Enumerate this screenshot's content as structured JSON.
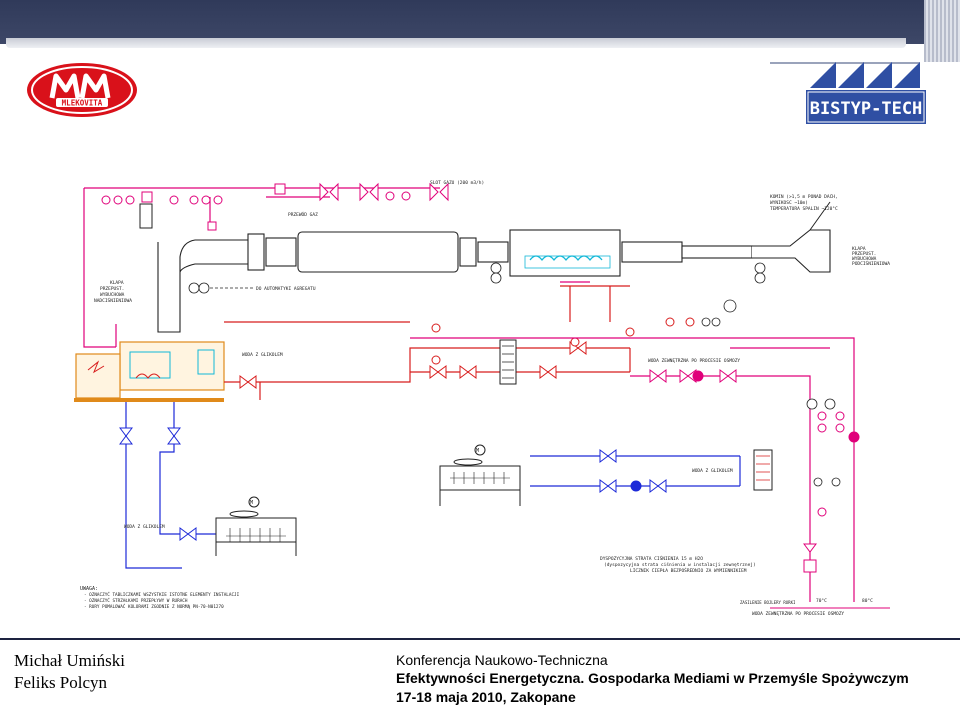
{
  "logos": {
    "left_text": "MLEKOVITA",
    "right_text": "BISTYP-TECH"
  },
  "diagram": {
    "labels": {
      "exhaust_top": "SLOT GAZU (200 m3/h)",
      "chimney_1": "KOMIN (>1,5 m PONAD DACH,",
      "chimney_2": "WYNIKOSC ~10m)",
      "chimney_3": "TEMPERATURA SPALIN ~120°C",
      "flap_right_1": "KLAPA",
      "flap_right_2": "PRZEPUST.",
      "flap_right_3": "WYBUCHOWA",
      "flap_right_4": "PODCIŚNIENIOWA",
      "flap_left_1": "KLAPA",
      "flap_left_2": "PRZEPUST.",
      "flap_left_3": "WYBUCHOWA",
      "flap_left_4": "NADCIŚNIENIOWA",
      "to_aggregate": "DO AUTOMATYKI AGREGATU",
      "gas_pipe": "PRZEWÓD GAZ",
      "glycol_1": "WODA Z GLIKOLEM",
      "external_water": "WODA ZEWNĘTRZNA PO PROCESIE OSMOZY",
      "glycol_2": "WODA Z GLIKOLEM",
      "glycol_3": "WODA Z GLIKOLEM",
      "notes_1": "DYSPOZYCYJNA STRATA CIŚNIENIA 15 m H2O",
      "notes_2": "(dyspozycyjna strata ciśnienia w instalacji zewnętrznej)",
      "notes_3": "LICZNIK CIEPŁA BEZPOŚREDNIO ZA WYMIENNIKIEM",
      "inlet_temp": "70°C",
      "outlet_temp": "80°C",
      "boiler_water": "ZASILENIE BOJLERY RURKI",
      "bottom_water": "WODA ZEWNĘTRZNA PO PROCESIE OSMOZY",
      "uwaga_title": "UWAGA:",
      "uwaga_1": "- OZNACZYĆ TABLICZKAMI WSZYSTKIE ISTOTNE ELEMENTY INSTALACJI",
      "uwaga_2": "- OZNACZYĆ STRZAŁKAMI PRZEPŁYWY W RURACH",
      "uwaga_3": "- RURY POMALOWAĆ KOLORAMI ZGODNIE Z NORMĄ PN-70-N01270"
    }
  },
  "footer": {
    "author_1": "Michał Umiński",
    "author_2": "Feliks Polcyn",
    "conf_line_1": "Konferencja Naukowo-Techniczna",
    "conf_line_2": "Efektywności Energetyczna. Gospodarka Mediami w Przemyśle Spożywczym",
    "conf_line_3": "17-18 maja 2010, Zakopane"
  },
  "colors": {
    "top_bar": "#353f5f",
    "magenta_pipe": "#e0007a",
    "red_pipe": "#d81d1d",
    "blue_pipe": "#1d2ad8",
    "cyan_unit": "#12b8d8",
    "orange_unit": "#e08a1a",
    "drawing_black": "#222222"
  }
}
